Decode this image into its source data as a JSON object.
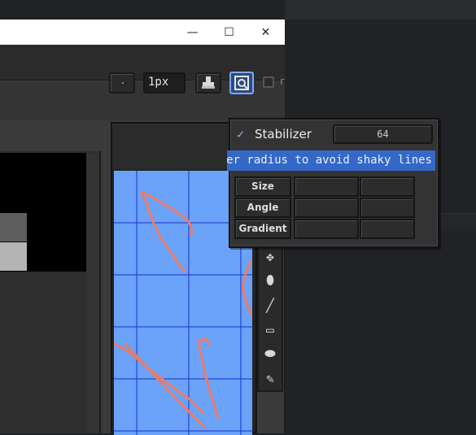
{
  "window": {
    "minimize_glyph": "—",
    "maximize_glyph": "☐",
    "close_glyph": "✕"
  },
  "toolbar": {
    "brush_size": "1px",
    "next_label_partial": "r"
  },
  "stabilizer_popup": {
    "checkbox_glyph": "✓",
    "label": "Stabilizer",
    "value": "64",
    "tooltip": "er radius to avoid shaky lines",
    "rows": [
      {
        "label": "Size"
      },
      {
        "label": "Angle"
      },
      {
        "label": "Gradient"
      }
    ]
  },
  "tools": [
    {
      "icon": "move-icon",
      "glyph": "✥"
    },
    {
      "icon": "fill-bucket-icon",
      "glyph": "⬮"
    },
    {
      "icon": "line-icon",
      "glyph": "╱"
    },
    {
      "icon": "rectangle-icon",
      "glyph": "▭"
    },
    {
      "icon": "ellipse-icon",
      "glyph": "⬬"
    },
    {
      "icon": "eyedropper-icon",
      "glyph": "✎"
    }
  ],
  "colors": {
    "canvas_bg": "#6aa3f8",
    "grid_lines": "#1a2fd0",
    "stroke": "#e97b6a",
    "accent": "#3468c8"
  }
}
